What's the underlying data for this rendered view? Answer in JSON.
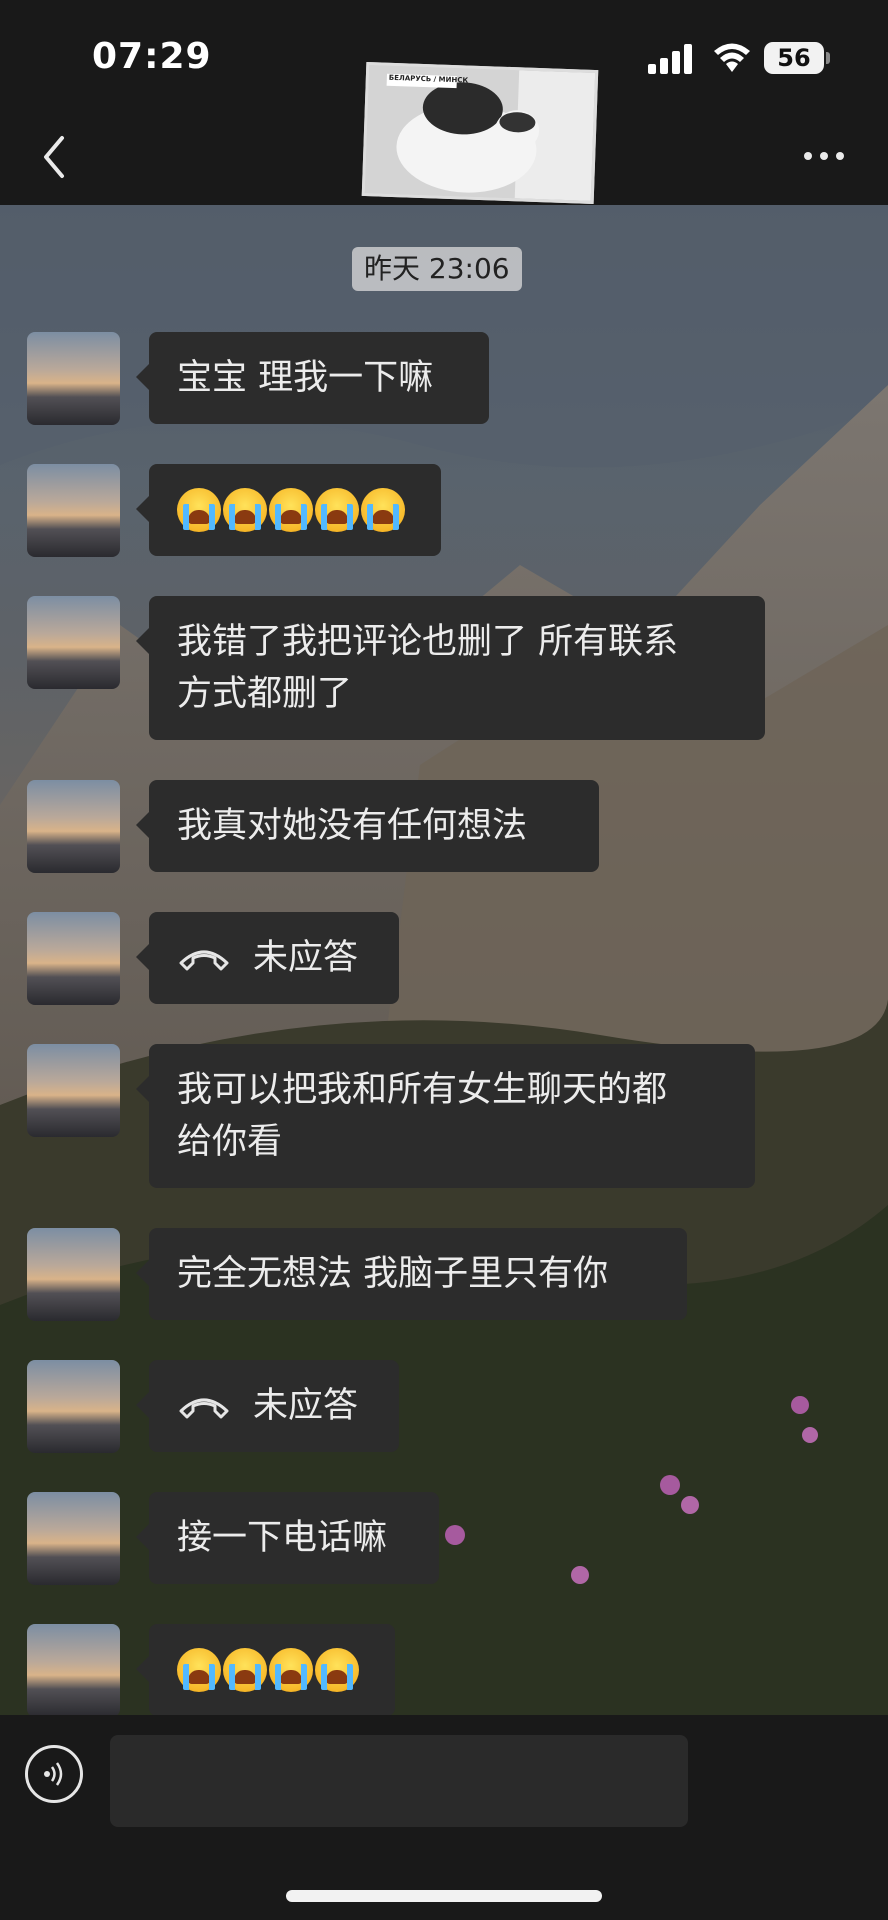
{
  "status_bar": {
    "time": "07:29",
    "battery": "56"
  },
  "nav": {
    "header_image": "cat-sticker",
    "header_image_caption": "БЕЛАРУСЬ / МИНСК"
  },
  "chat": {
    "timestamp": "昨天 23:06",
    "messages": [
      {
        "type": "text",
        "text": "宝宝 理我一下嘛"
      },
      {
        "type": "emoji",
        "emoji": "loudly-crying-face",
        "count": 5
      },
      {
        "type": "text",
        "lines": [
          "我错了我把评论也删了 所有联系",
          "方式都删了"
        ]
      },
      {
        "type": "text",
        "text": "我真对她没有任何想法"
      },
      {
        "type": "call",
        "text": "未应答"
      },
      {
        "type": "text",
        "lines": [
          "我可以把我和所有女生聊天的都",
          "给你看"
        ]
      },
      {
        "type": "text",
        "text": "完全无想法 我脑子里只有你"
      },
      {
        "type": "call",
        "text": "未应答"
      },
      {
        "type": "text",
        "text": "接一下电话嘛"
      },
      {
        "type": "emoji",
        "emoji": "loudly-crying-face",
        "count": 4
      }
    ]
  },
  "input": {
    "value": "",
    "placeholder": ""
  },
  "colors": {
    "bar_bg": "#191919",
    "bubble_bg": "#2c2c2c",
    "bubble_text": "#ececec",
    "timestamp_bg": "#dcdcdc"
  }
}
